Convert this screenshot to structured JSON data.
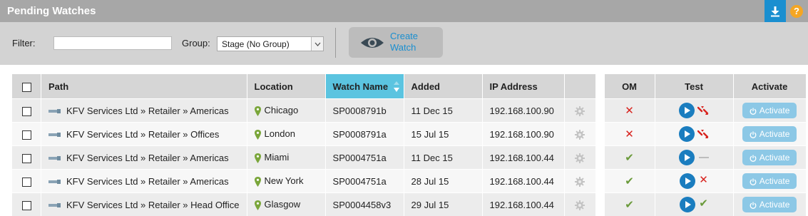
{
  "header": {
    "title": "Pending Watches",
    "download_icon": "download-icon",
    "help_label": "?"
  },
  "toolbar": {
    "filter_label": "Filter:",
    "filter_value": "",
    "group_label": "Group:",
    "group_value": "Stage (No Group)",
    "create_line1": "Create",
    "create_line2": "Watch",
    "create_icon": "eye-icon"
  },
  "table": {
    "columns": {
      "path": "Path",
      "location": "Location",
      "watch_name": "Watch Name",
      "added": "Added",
      "ip": "IP Address",
      "om": "OM",
      "test": "Test",
      "activate": "Activate"
    },
    "sorted_column": "watch_name",
    "activate_label": "Activate",
    "rows": [
      {
        "path": "KFV Services Ltd » Retailer » Americas",
        "location": "Chicago",
        "watch_name": "SP0008791b",
        "added": "11 Dec 15",
        "ip": "192.168.100.90",
        "om": "fail",
        "test_result": "broken-link"
      },
      {
        "path": "KFV Services Ltd » Retailer » Offices",
        "location": "London",
        "watch_name": "SP0008791a",
        "added": "15 Jul 15",
        "ip": "192.168.100.90",
        "om": "fail",
        "test_result": "broken-link"
      },
      {
        "path": "KFV Services Ltd » Retailer » Americas",
        "location": "Miami",
        "watch_name": "SP0004751a",
        "added": "11 Dec 15",
        "ip": "192.168.100.44",
        "om": "pass",
        "test_result": "none"
      },
      {
        "path": "KFV Services Ltd » Retailer » Americas",
        "location": "New York",
        "watch_name": "SP0004751a",
        "added": "28 Jul 15",
        "ip": "192.168.100.44",
        "om": "pass",
        "test_result": "fail"
      },
      {
        "path": "KFV Services Ltd » Retailer » Head Office",
        "location": "Glasgow",
        "watch_name": "SP0004458v3",
        "added": "29 Jul 15",
        "ip": "192.168.100.44",
        "om": "pass",
        "test_result": "pass"
      }
    ]
  },
  "colors": {
    "accent": "#1a8fd0",
    "sorted_header": "#5bc4e0",
    "fail": "#d8241f",
    "pass": "#6a9a3a",
    "activate_button": "#8cc8e6",
    "help": "#f5a623"
  }
}
